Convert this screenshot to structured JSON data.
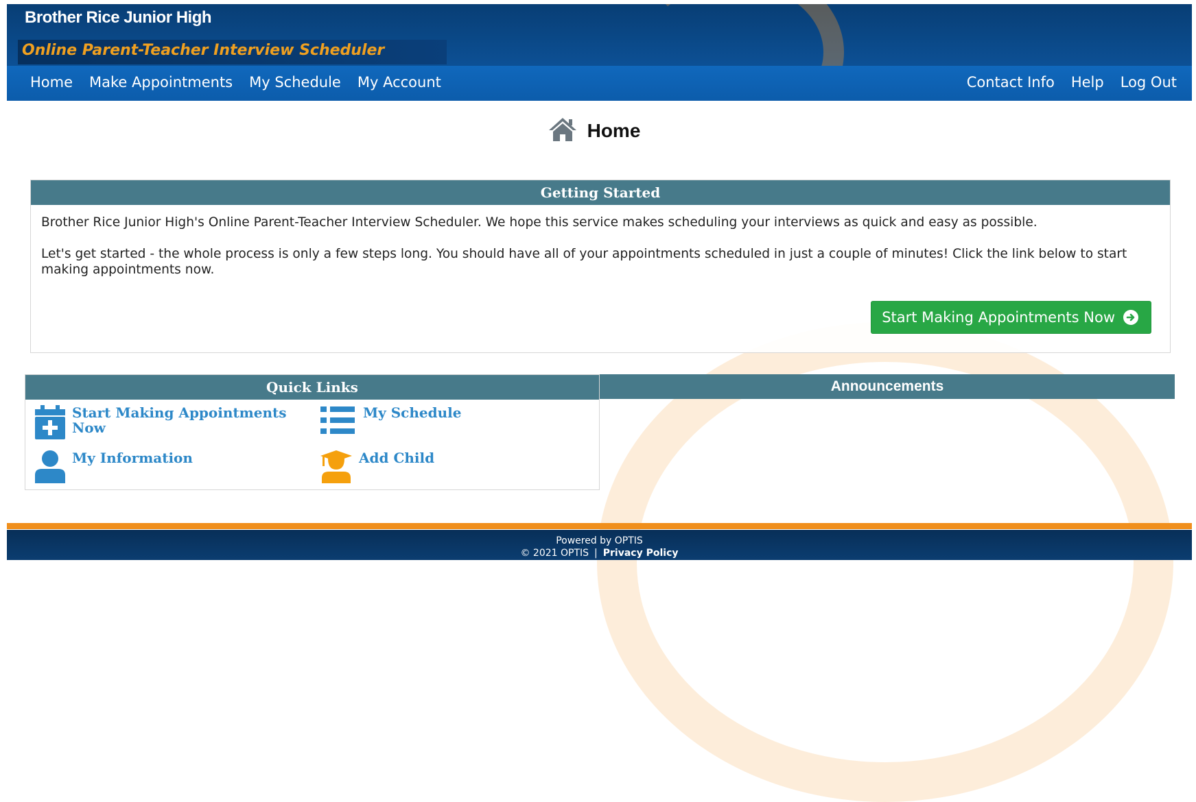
{
  "header": {
    "school_name": "Brother Rice Junior High",
    "tagline": "Online Parent-Teacher Interview Scheduler"
  },
  "nav": {
    "left": [
      "Home",
      "Make Appointments",
      "My Schedule",
      "My Account"
    ],
    "right": [
      "Contact Info",
      "Help",
      "Log Out"
    ]
  },
  "page": {
    "title": "Home",
    "title_icon": "home-icon"
  },
  "getting_started": {
    "heading": "Getting Started",
    "paragraph1": "Brother Rice Junior High's Online Parent-Teacher Interview Scheduler. We hope this service makes scheduling your interviews as quick and easy as possible.",
    "paragraph2": "Let's get started - the whole process is only a few steps long. You should have all of your appointments scheduled in just a couple of minutes! Click the link below to start making appointments now.",
    "button_label": "Start Making Appointments Now",
    "button_icon": "arrow-circle-right-icon"
  },
  "quick_links": {
    "heading": "Quick Links",
    "items": [
      {
        "label": "Start Making Appointments Now",
        "icon": "calendar-plus-icon"
      },
      {
        "label": "My Schedule",
        "icon": "list-icon"
      },
      {
        "label": "My Information",
        "icon": "user-icon"
      },
      {
        "label": "Add Child",
        "icon": "graduate-icon"
      }
    ]
  },
  "announcements": {
    "heading": "Announcements"
  },
  "footer": {
    "powered_by": "Powered by OPTIS",
    "copyright": "© 2021 OPTIS",
    "separator": "|",
    "privacy": "Privacy Policy"
  },
  "colors": {
    "header_blue": "#0c5cab",
    "tagline_orange": "#f0a020",
    "panel_header": "#477a8a",
    "button_green": "#28a745",
    "link_blue": "#2d88c8",
    "footer_orange": "#f08f1c"
  }
}
